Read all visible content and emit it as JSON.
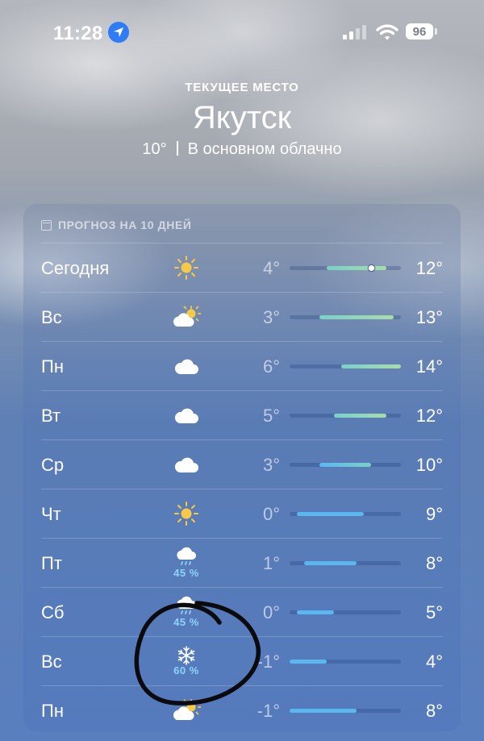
{
  "status": {
    "time": "11:28",
    "battery": "96"
  },
  "header": {
    "caption": "ТЕКУЩЕЕ МЕСТО",
    "city": "Якутск",
    "temp": "10°",
    "condition": "В основном облачно"
  },
  "forecast": {
    "title": "ПРОГНОЗ НА 10 ДНЕЙ",
    "scale_min": -1,
    "scale_max": 14,
    "days": [
      {
        "day": "Сегодня",
        "icon": "sun-icon",
        "precip": "",
        "low": "4°",
        "high": "12°",
        "low_v": 4,
        "high_v": 12,
        "current_v": 10
      },
      {
        "day": "Вс",
        "icon": "partly-cloudy-icon",
        "precip": "",
        "low": "3°",
        "high": "13°",
        "low_v": 3,
        "high_v": 13
      },
      {
        "day": "Пн",
        "icon": "cloud-icon",
        "precip": "",
        "low": "6°",
        "high": "14°",
        "low_v": 6,
        "high_v": 14
      },
      {
        "day": "Вт",
        "icon": "cloud-icon",
        "precip": "",
        "low": "5°",
        "high": "12°",
        "low_v": 5,
        "high_v": 12
      },
      {
        "day": "Ср",
        "icon": "cloud-icon",
        "precip": "",
        "low": "3°",
        "high": "10°",
        "low_v": 3,
        "high_v": 10
      },
      {
        "day": "Чт",
        "icon": "sun-icon",
        "precip": "",
        "low": "0°",
        "high": "9°",
        "low_v": 0,
        "high_v": 9
      },
      {
        "day": "Пт",
        "icon": "rain-icon",
        "precip": "45 %",
        "low": "1°",
        "high": "8°",
        "low_v": 1,
        "high_v": 8
      },
      {
        "day": "Сб",
        "icon": "rain-icon",
        "precip": "45 %",
        "low": "0°",
        "high": "5°",
        "low_v": 0,
        "high_v": 5
      },
      {
        "day": "Вс",
        "icon": "snowflake-icon",
        "precip": "60 %",
        "low": "-1°",
        "high": "4°",
        "low_v": -1,
        "high_v": 4
      },
      {
        "day": "Пн",
        "icon": "partly-cloudy-icon",
        "precip": "",
        "low": "-1°",
        "high": "8°",
        "low_v": -1,
        "high_v": 8
      }
    ]
  },
  "colors": {
    "cool": "#5ab8ee",
    "mild": "#79d1c8",
    "warm": "#a8dcaa"
  }
}
